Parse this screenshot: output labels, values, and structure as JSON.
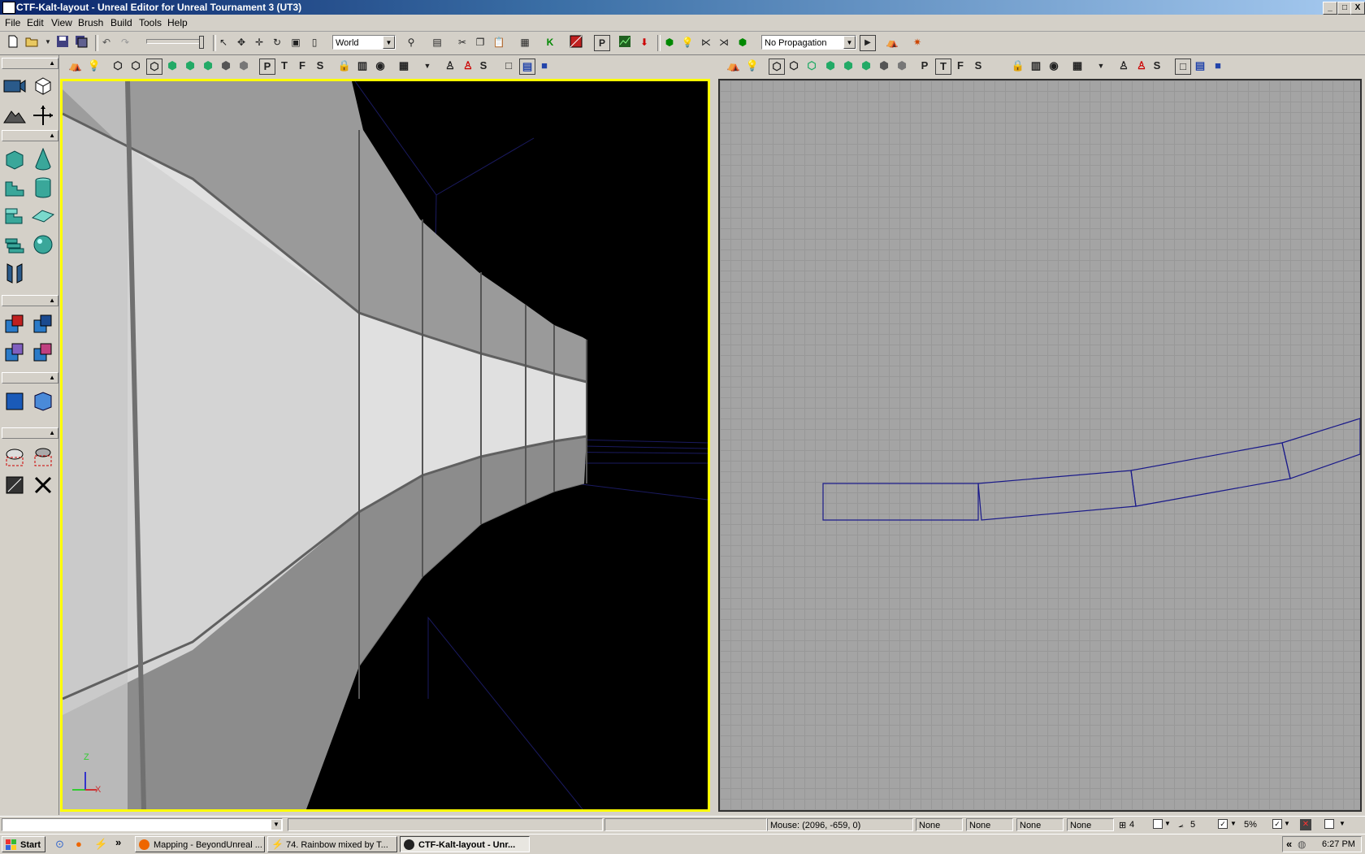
{
  "window": {
    "title": "CTF-Kalt-layout - Unreal Editor for Unreal Tournament 3 (UT3)",
    "controls": [
      "_",
      "□",
      "X"
    ]
  },
  "menu": [
    "File",
    "Edit",
    "View",
    "Brush",
    "Build",
    "Tools",
    "Help"
  ],
  "toolbar": {
    "coordinate_system": "World",
    "propagation": "No Propagation",
    "icons": [
      "new-icon",
      "open-icon",
      "save-icon",
      "save-all-icon",
      "undo-icon",
      "redo-icon",
      "select-icon",
      "translate-icon",
      "move-icon",
      "rotate-icon",
      "scale-icon",
      "nonuniform-scale-icon",
      "find-icon",
      "view-icon",
      "cut-icon",
      "copy-icon",
      "paste-icon",
      "grid-icon",
      "kismet-icon",
      "matinee-icon",
      "p-icon",
      "content-browser-icon",
      "build-icon",
      "lighting-icon",
      "paths-icon",
      "cover-icon",
      "geometry-icon",
      "build-all-icon",
      "play-icon",
      "play-in-editor-icon",
      "cook-icon"
    ]
  },
  "viewport_toolbar_letters": [
    "P",
    "T",
    "F",
    "S",
    "S"
  ],
  "viewports": {
    "left": {
      "mode": "perspective",
      "axis_labels": [
        "Z",
        "X"
      ],
      "active": true
    },
    "right": {
      "mode": "top-orthographic",
      "active": false
    }
  },
  "status": {
    "mouse": "Mouse: (2096, -659, 0)",
    "fields": [
      "None",
      "None",
      "None",
      "None"
    ],
    "grid": "4",
    "rotation_snap": "5",
    "scale_snap": "5%"
  },
  "taskbar": {
    "start": "Start",
    "overflow": "»",
    "tasks": [
      {
        "label": "Mapping - BeyondUnreal ...",
        "active": false
      },
      {
        "label": "74. Rainbow mixed by T...",
        "active": false
      },
      {
        "label": "CTF-Kalt-layout - Unr...",
        "active": true
      }
    ],
    "tray_arrow": "«",
    "clock": "6:27 PM"
  },
  "colors": {
    "active_viewport_border": "#ffff00",
    "titlebar_start": "#0a246a",
    "wireframe": "#1a1a80",
    "ortho_background": "#a4a4a4"
  }
}
